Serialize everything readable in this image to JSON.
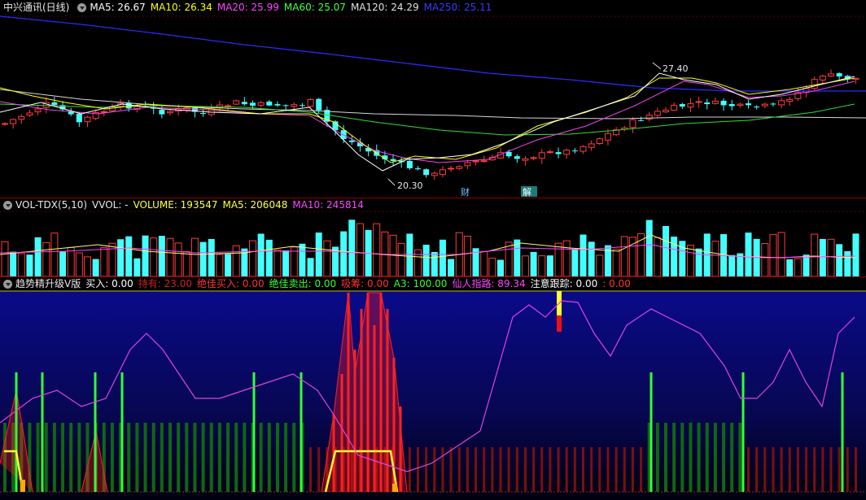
{
  "main": {
    "title": "中兴通讯(日线)",
    "ma": [
      {
        "label": "MA5: 26.67",
        "color": "#ffffff"
      },
      {
        "label": "MA10: 26.34",
        "color": "#ffff00"
      },
      {
        "label": "MA20: 25.99",
        "color": "#ff44ff"
      },
      {
        "label": "MA60: 25.07",
        "color": "#44ff44"
      },
      {
        "label": "MA120: 24.29",
        "color": "#e0e0e0"
      },
      {
        "label": "MA250: 25.11",
        "color": "#3a3aff"
      }
    ],
    "high_label": "27.40",
    "low_label": "20.30",
    "event_cai": "财",
    "event_jie": "解"
  },
  "volume": {
    "name": "VOL-TDX(5,10)",
    "vvol": "VVOL: -",
    "volume": "VOLUME: 193547",
    "ma5": "MA5: 206048",
    "ma10": "MA10: 245814"
  },
  "indicator": {
    "name": "趋势精升级V版",
    "items": [
      {
        "label": "买入: 0.00",
        "color": "#ffffff"
      },
      {
        "label": "持有: 23.00",
        "color": "#cc2222"
      },
      {
        "label": "绝佳买入: 0.00",
        "color": "#ff3333"
      },
      {
        "label": "绝佳卖出: 0.00",
        "color": "#33ff33"
      },
      {
        "label": "吸筹: 0.00",
        "color": "#ff3333"
      },
      {
        "label": "A3: 100.00",
        "color": "#33ff33"
      },
      {
        "label": "仙人指路: 89.34",
        "color": "#ff44ff"
      },
      {
        "label": "注意跟踪: 0.00",
        "color": "#ffffff"
      },
      {
        "label": ": 0.00",
        "color": "#ff3333"
      }
    ]
  },
  "colors": {
    "up": "#ff3b3b",
    "down": "#44ffff",
    "bg": "#000000"
  }
}
